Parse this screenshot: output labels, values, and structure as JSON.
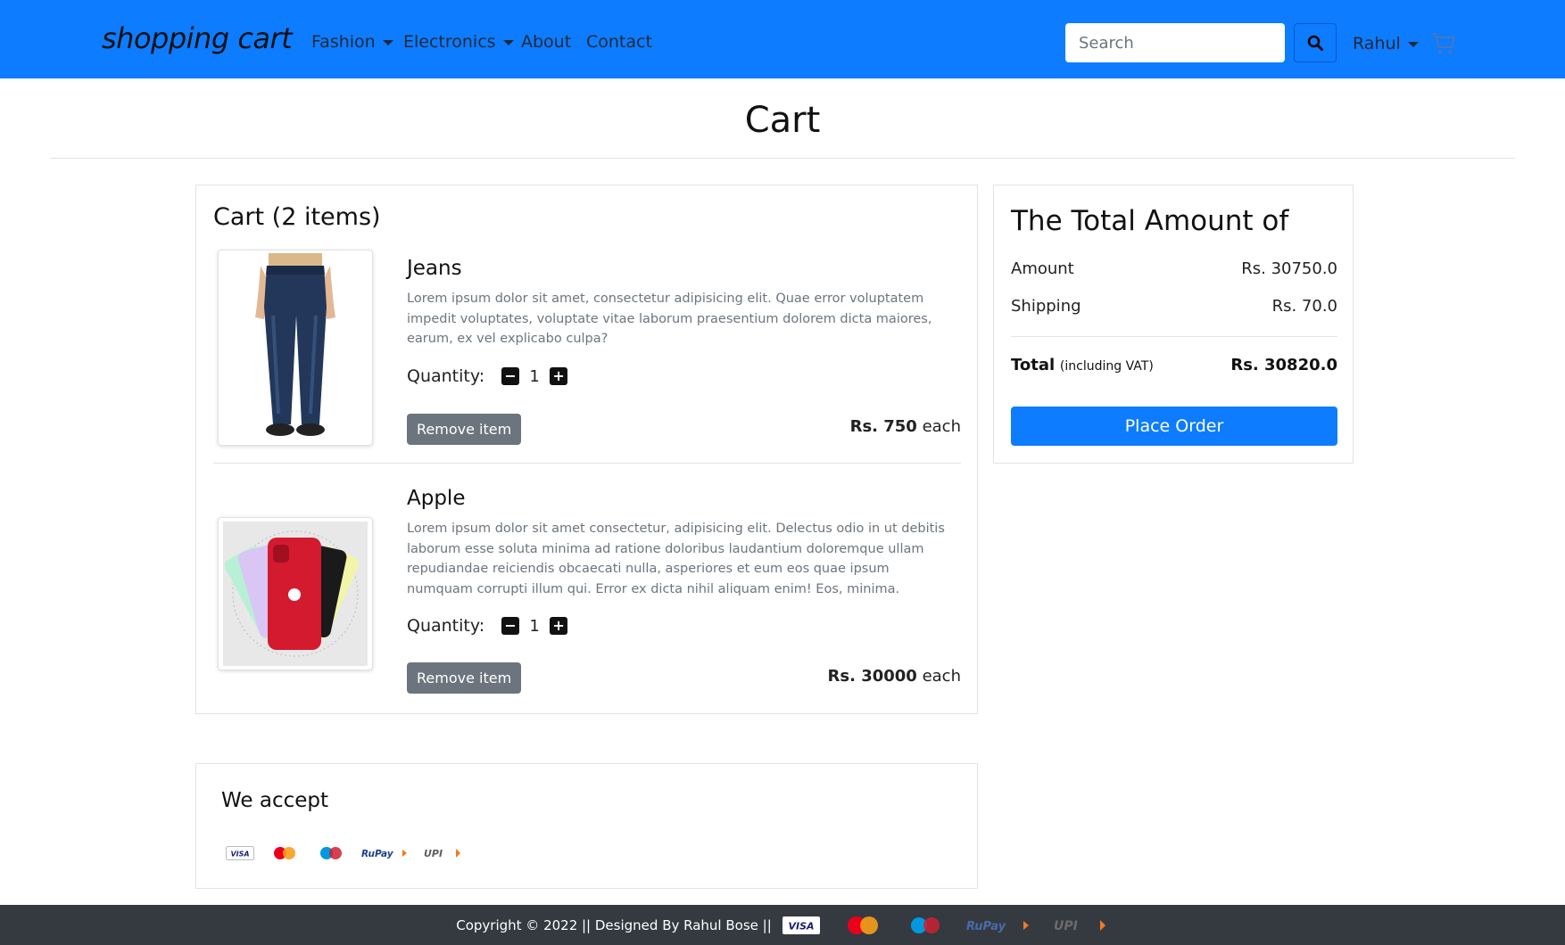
{
  "navbar": {
    "brand": "shopping cart",
    "items": [
      {
        "label": "Fashion",
        "dropdown": true
      },
      {
        "label": "Electronics",
        "dropdown": true
      },
      {
        "label": "About",
        "dropdown": false
      },
      {
        "label": "Contact",
        "dropdown": false
      }
    ],
    "search_placeholder": "Search",
    "user": "Rahul"
  },
  "page": {
    "title": "Cart"
  },
  "cart": {
    "heading": "Cart (2 items)",
    "quantity_label": "Quantity:",
    "remove_label": "Remove item",
    "each_label": "each",
    "items": [
      {
        "name": "Jeans",
        "description": "Lorem ipsum dolor sit amet, consectetur adipisicing elit. Quae error voluptatem impedit voluptates, voluptate vitae laborum praesentium dolorem dicta maiores, earum, ex vel explicabo culpa?",
        "quantity": "1",
        "price": "Rs. 750"
      },
      {
        "name": "Apple",
        "description": "Lorem ipsum dolor sit amet consectetur, adipisicing elit. Delectus odio in ut debitis laborum esse soluta minima ad ratione doloribus laudantium doloremque ullam repudiandae reiciendis obcaecati nulla, asperiores et eum eos quae ipsum numquam corrupti illum qui. Error ex dicta nihil aliquam enim! Eos, minima.",
        "quantity": "1",
        "price": "Rs. 30000"
      }
    ]
  },
  "summary": {
    "heading": "The Total Amount of",
    "amount_label": "Amount",
    "amount_value": "Rs. 30750.0",
    "shipping_label": "Shipping",
    "shipping_value": "Rs. 70.0",
    "total_label": "Total",
    "total_note": "(including VAT)",
    "total_value": "Rs. 30820.0",
    "place_order_label": "Place Order"
  },
  "accept": {
    "heading": "We accept",
    "methods": [
      "VISA",
      "MasterCard",
      "Maestro",
      "RuPay",
      "UPI"
    ]
  },
  "footer": {
    "text": "Copyright © 2022 || Designed By Rahul Bose ||"
  },
  "colors": {
    "primary": "#0d7cff",
    "secondary": "#6c757d",
    "footer_bg": "#343a40"
  }
}
